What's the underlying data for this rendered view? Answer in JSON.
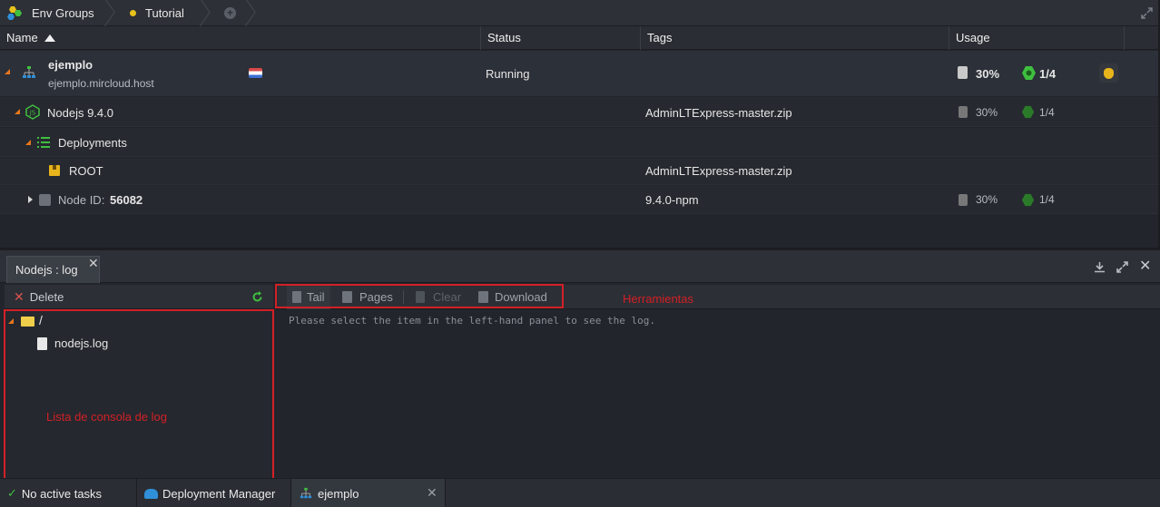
{
  "topbar": {
    "env_groups": "Env Groups",
    "tutorial": "Tutorial"
  },
  "columns": {
    "name": "Name",
    "status": "Status",
    "tags": "Tags",
    "usage": "Usage"
  },
  "rows": {
    "env": {
      "name": "ejemplo",
      "host": "ejemplo.mircloud.host",
      "status": "Running",
      "usage_pct": "30%",
      "usage_nodes": "1/4"
    },
    "nodejs": {
      "name": "Nodejs 9.4.0",
      "tag": "AdminLTExpress-master.zip",
      "usage_pct": "30%",
      "usage_nodes": "1/4"
    },
    "deployments": {
      "name": "Deployments"
    },
    "root": {
      "name": "ROOT",
      "tag": "AdminLTExpress-master.zip"
    },
    "node": {
      "label": "Node ID:",
      "id": "56082",
      "tag": "9.4.0-npm",
      "usage_pct": "30%",
      "usage_nodes": "1/4"
    }
  },
  "log_panel": {
    "tab_title": "Nodejs : log",
    "delete_label": "Delete",
    "tools": {
      "tail": "Tail",
      "pages": "Pages",
      "clear": "Clear",
      "download": "Download"
    },
    "tree_root": "/",
    "file": "nodejs.log",
    "placeholder": "Please select the item in the left-hand panel to see the log.",
    "annotation_tools": "Herramientas",
    "annotation_list": "Lista de consola de log"
  },
  "statusbar": {
    "tasks": "No active tasks",
    "deployment_manager": "Deployment Manager",
    "env_tab": "ejemplo"
  },
  "colors": {
    "accent_orange": "#e8761c",
    "green": "#3fbf3f",
    "red_annotation": "#d32027"
  }
}
